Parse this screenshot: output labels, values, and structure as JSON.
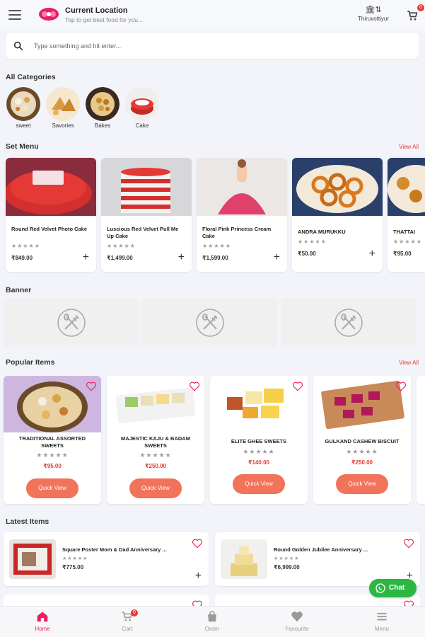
{
  "header": {
    "location_title": "Current Location",
    "location_subtitle": "Top to get best food for you...",
    "store_label": "Thiruvottiyur",
    "cart_count": "0"
  },
  "search": {
    "placeholder": "Type something and hit enter..."
  },
  "categories": {
    "title": "All Categories",
    "items": [
      {
        "label": "sweet"
      },
      {
        "label": "Savories"
      },
      {
        "label": "Bakes"
      },
      {
        "label": "Cake"
      }
    ]
  },
  "set_menu": {
    "title": "Set Menu",
    "view_all": "View All",
    "items": [
      {
        "name": "Round Red Velvet Photo Cake",
        "price": "₹849.00",
        "stars": "★★★★★"
      },
      {
        "name": "Luscious Red Velvet Pull Me Up Cake",
        "price": "₹1,499.00",
        "stars": "★★★★★"
      },
      {
        "name": "Floral Pink Princess Cream Cake",
        "price": "₹1,599.00",
        "stars": "★★★★★"
      },
      {
        "name": "ANDRA MURUKKU",
        "price": "₹50.00",
        "stars": "★★★★★"
      },
      {
        "name": "THATTAI",
        "price": "₹95.00",
        "stars": "★★★★★"
      }
    ]
  },
  "banner": {
    "title": "Banner"
  },
  "popular": {
    "title": "Popular Items",
    "view_all": "View All",
    "quick_view_label": "Quick View",
    "items": [
      {
        "name": "TRADITIONAL ASSORTED SWEETS",
        "price": "₹95.00",
        "stars": "★★★★★"
      },
      {
        "name": "MAJESTIC KAJU & BADAM SWEETS",
        "price": "₹250.00",
        "stars": "★★★★★"
      },
      {
        "name": "ELITE GHEE SWEETS",
        "price": "₹140.00",
        "stars": "★★★★★"
      },
      {
        "name": "GULKAND CASHEW BISCUIT",
        "price": "₹250.00",
        "stars": "★★★★★"
      }
    ]
  },
  "latest": {
    "title": "Latest Items",
    "items": [
      {
        "name": "Square Poster Mom & Dad Anniversary ...",
        "price": "₹775.00",
        "stars": "★★★★★"
      },
      {
        "name": "Round Golden Jubilee Anniversary ...",
        "price": "₹6,999.00",
        "stars": "★★★★★"
      }
    ]
  },
  "chat": {
    "label": "Chat"
  },
  "bottom_nav": {
    "items": [
      {
        "label": "Home"
      },
      {
        "label": "Cart"
      },
      {
        "label": "Order"
      },
      {
        "label": "Favourite"
      },
      {
        "label": "Menu"
      }
    ],
    "cart_badge": "0"
  },
  "colors": {
    "accent": "#e53935",
    "brand_pink": "#e91e63",
    "quick_view": "#f0735a",
    "chat_green": "#2bb741"
  }
}
